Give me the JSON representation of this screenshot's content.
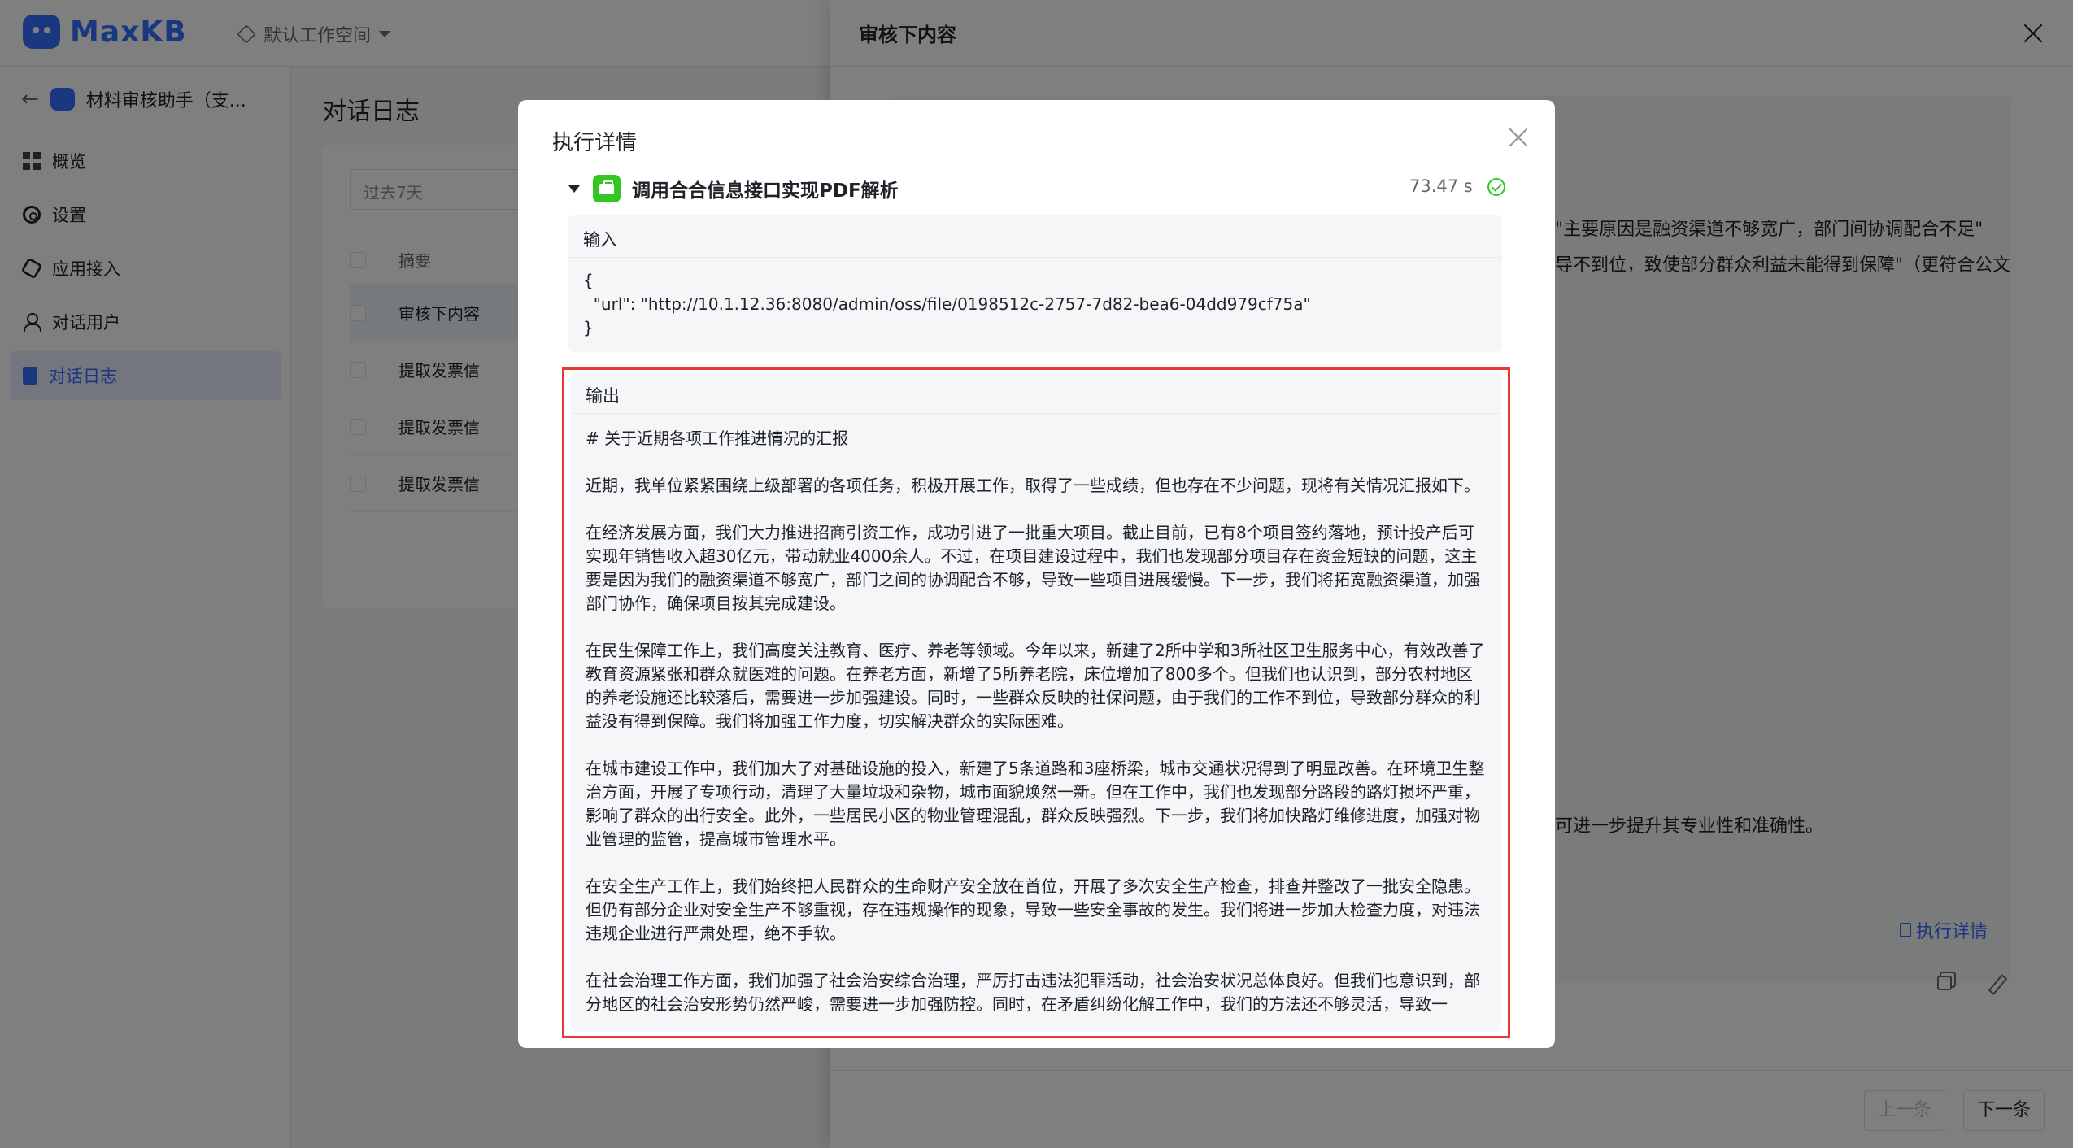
{
  "app": {
    "logo_text": "MaxKB",
    "workspace": "默认工作空间",
    "app_name": "材料审核助手（支..."
  },
  "sidebar": {
    "items": [
      {
        "label": "概览",
        "icon": "grid-icon"
      },
      {
        "label": "设置",
        "icon": "gear-icon"
      },
      {
        "label": "应用接入",
        "icon": "hexagon-icon"
      },
      {
        "label": "对话用户",
        "icon": "user-icon"
      },
      {
        "label": "对话日志",
        "icon": "document-icon",
        "active": true
      }
    ]
  },
  "main": {
    "title": "对话日志",
    "date_filter": "过去7天",
    "column_summary": "摘要",
    "rows": [
      "审核下内容",
      "提取发票信",
      "提取发票信",
      "提取发票信"
    ]
  },
  "drawer": {
    "title": "审核下内容",
    "line1": "\"主要原因是融资渠道不够宽广，部门间协调配合不足\"",
    "line2": "导不到位，致使部分群众利益未能得到保障\"（更符合公文",
    "line3": "可进一步提升其专业性和准确性。",
    "exec_link": "执行详情",
    "prev_button": "上一条",
    "next_button": "下一条"
  },
  "modal": {
    "title": "执行详情",
    "node_name": "调用合合信息接口实现PDF解析",
    "duration": "73.47 s",
    "input_label": "输入",
    "input_json": "{\n  \"url\": \"http://10.1.12.36:8080/admin/oss/file/0198512c-2757-7d82-bea6-04dd979cf75a\"\n}",
    "output_label": "输出",
    "output_paragraphs": [
      "# 关于近期各项工作推进情况的汇报",
      "近期，我单位紧紧围绕上级部署的各项任务，积极开展工作，取得了一些成绩，但也存在不少问题，现将有关情况汇报如下。",
      "在经济发展方面，我们大力推进招商引资工作，成功引进了一批重大项目。截止目前，已有8个项目签约落地，预计投产后可实现年销售收入超30亿元，带动就业4000余人。不过，在项目建设过程中，我们也发现部分项目存在资金短缺的问题，这主要是因为我们的融资渠道不够宽广，部门之间的协调配合不够，导致一些项目进展缓慢。下一步，我们将拓宽融资渠道，加强部门协作，确保项目按其完成建设。",
      "在民生保障工作上，我们高度关注教育、医疗、养老等领域。今年以来，新建了2所中学和3所社区卫生服务中心，有效改善了教育资源紧张和群众就医难的问题。在养老方面，新增了5所养老院，床位增加了800多个。但我们也认识到，部分农村地区的养老设施还比较落后，需要进一步加强建设。同时，一些群众反映的社保问题，由于我们的工作不到位，导致部分群众的利益没有得到保障。我们将加强工作力度，切实解决群众的实际困难。",
      "在城市建设工作中，我们加大了对基础设施的投入，新建了5条道路和3座桥梁，城市交通状况得到了明显改善。在环境卫生整治方面，开展了专项行动，清理了大量垃圾和杂物，城市面貌焕然一新。但在工作中，我们也发现部分路段的路灯损坏严重，影响了群众的出行安全。此外，一些居民小区的物业管理混乱，群众反映强烈。下一步，我们将加快路灯维修进度，加强对物业管理的监管，提高城市管理水平。",
      "在安全生产工作上，我们始终把人民群众的生命财产安全放在首位，开展了多次安全生产检查，排查并整改了一批安全隐患。但仍有部分企业对安全生产不够重视，存在违规操作的现象，导致一些安全事故的发生。我们将进一步加大检查力度，对违法违规企业进行严肃处理，绝不手软。",
      "在社会治理工作方面，我们加强了社会治安综合治理，严厉打击违法犯罪活动，社会治安状况总体良好。但我们也意识到，部分地区的社会治安形势仍然严峻，需要进一步加强防控。同时，在矛盾纠纷化解工作中，我们的方法还不够灵活，导致一"
    ]
  },
  "colors": {
    "brand": "#3370ff",
    "success": "#34c724",
    "highlight_border": "#e53935"
  }
}
